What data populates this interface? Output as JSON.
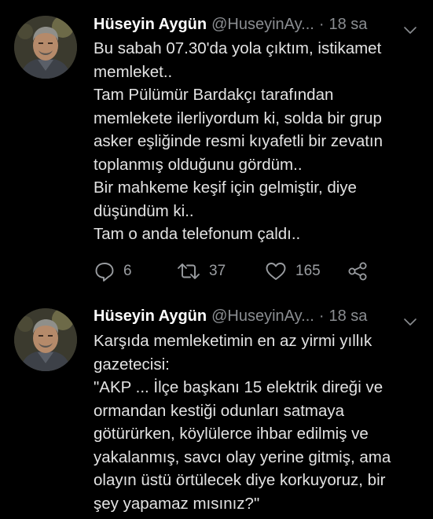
{
  "colors": {
    "background": "#000000",
    "name_text": "#ffffff",
    "body_text": "#e3e3e3",
    "secondary_text": "#8a8d91",
    "icon": "#9a9da1"
  },
  "tweets": [
    {
      "author": {
        "display_name": "Hüseyin Aygün",
        "handle": "@HuseyinAy...",
        "avatar_icon": "avatar-photo"
      },
      "separator": "·",
      "time": "18 sa",
      "menu_icon": "chevron-down-icon",
      "lines": [
        "Bu sabah 07.30'da yola çıktım, istikamet",
        "memleket..",
        "Tam Pülümür Bardakçı tarafından",
        "memlekete ilerliyordum  ki, solda bir grup",
        "asker eşliğinde resmi kıyafetli bir zevatın",
        "toplanmış olduğunu gördüm..",
        "Bir mahkeme keşif için gelmiştir, diye",
        "düşündüm ki..",
        "Tam o anda telefonum çaldı.."
      ],
      "actions": {
        "replies": "6",
        "retweets": "37",
        "likes": "165",
        "reply_icon": "reply-icon",
        "retweet_icon": "retweet-icon",
        "like_icon": "heart-icon",
        "share_icon": "share-icon"
      }
    },
    {
      "author": {
        "display_name": "Hüseyin Aygün",
        "handle": "@HuseyinAy...",
        "avatar_icon": "avatar-photo"
      },
      "separator": "·",
      "time": "18 sa",
      "menu_icon": "chevron-down-icon",
      "lines": [
        "Karşıda memleketimin en az yirmi yıllık",
        "gazetecisi:",
        "\"AKP ... İlçe başkanı 15 elektrik direği ve",
        "ormandan kestiği odunları satmaya",
        "götürürken, köylülerce ihbar edilmiş ve",
        "yakalanmış, savcı olay yerine gitmiş, ama",
        "olayın üstü örtülecek diye korkuyoruz, bir",
        "şey yapamaz mısınız?\""
      ]
    }
  ]
}
